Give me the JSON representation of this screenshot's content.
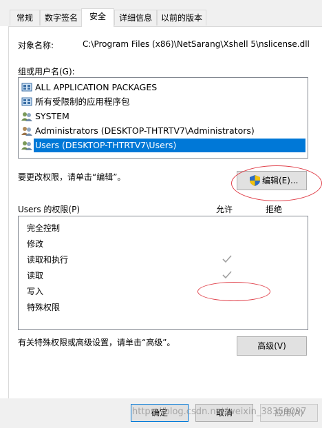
{
  "tabs": [
    {
      "label": "常规"
    },
    {
      "label": "数字签名"
    },
    {
      "label": "安全"
    },
    {
      "label": "详细信息"
    },
    {
      "label": "以前的版本"
    }
  ],
  "object_name_label": "对象名称:",
  "object_name_value": "C:\\Program Files (x86)\\NetSarang\\Xshell 5\\nslicense.dll",
  "groups_label": "组或用户名(G):",
  "groups": [
    {
      "name": "ALL APPLICATION PACKAGES",
      "icon": "app-packages-icon"
    },
    {
      "name": "所有受限制的应用程序包",
      "icon": "app-packages-icon"
    },
    {
      "name": "SYSTEM",
      "icon": "user-group-icon"
    },
    {
      "name": "Administrators (DESKTOP-THTRTV7\\Administrators)",
      "icon": "user-group-icon"
    },
    {
      "name": "Users (DESKTOP-THTRTV7\\Users)",
      "icon": "user-group-icon",
      "selected": true
    }
  ],
  "edit_hint": "要更改权限，请单击“编辑”。",
  "edit_button": "编辑(E)...",
  "permissions_label": "Users 的权限(P)",
  "allow_header": "允许",
  "deny_header": "拒绝",
  "permissions": [
    {
      "name": "完全控制",
      "allow": false,
      "deny": false
    },
    {
      "name": "修改",
      "allow": false,
      "deny": false
    },
    {
      "name": "读取和执行",
      "allow": true,
      "deny": false
    },
    {
      "name": "读取",
      "allow": true,
      "deny": false
    },
    {
      "name": "写入",
      "allow": false,
      "deny": false
    },
    {
      "name": "特殊权限",
      "allow": false,
      "deny": false
    }
  ],
  "advanced_hint": "有关特殊权限或高级设置，请单击“高级”。",
  "advanced_button": "高级(V)",
  "ok_button": "确定",
  "cancel_button": "取消",
  "apply_button": "应用(A)",
  "watermark": "https://blog.csdn.net/weixin_38359097",
  "colors": {
    "selection": "#0078d7",
    "annotation": "#e0404a",
    "check": "#a0a0a0"
  }
}
